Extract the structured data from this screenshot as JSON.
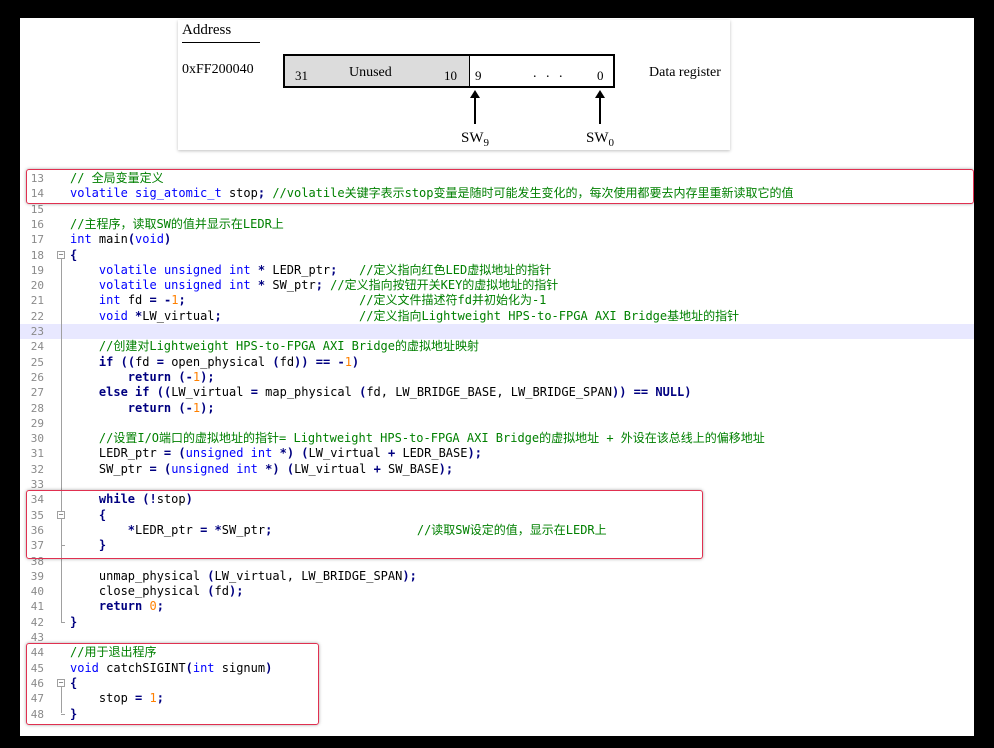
{
  "diagram": {
    "address_header": "Address",
    "address_value": "0xFF200040",
    "bit_31": "31",
    "unused_label": "Unused",
    "bit_10": "10",
    "bit_9": "9",
    "ellipsis": ". . .",
    "bit_0": "0",
    "register_name": "Data register",
    "sw9_base": "SW",
    "sw9_sub": "9",
    "sw0_base": "SW",
    "sw0_sub": "0"
  },
  "editor": {
    "lines": [
      {
        "n": "13",
        "code": "// 全局变量定义"
      },
      {
        "n": "14",
        "code": "volatile sig_atomic_t stop; //volatile关键字表示stop变量是随时可能发生变化的，每次使用都要去内存里重新读取它的值"
      },
      {
        "n": "15",
        "code": ""
      },
      {
        "n": "16",
        "code": "//主程序，读取SW的值并显示在LEDR上"
      },
      {
        "n": "17",
        "code": "int main(void)"
      },
      {
        "n": "18",
        "code": "{"
      },
      {
        "n": "19",
        "code": "    volatile unsigned int * LEDR_ptr;   //定义指向红色LED虚拟地址的指针"
      },
      {
        "n": "20",
        "code": "    volatile unsigned int * SW_ptr; //定义指向按钮开关KEY的虚拟地址的指针"
      },
      {
        "n": "21",
        "code": "    int fd = -1;                        //定义文件描述符fd并初始化为-1"
      },
      {
        "n": "22",
        "code": "    void *LW_virtual;                   //定义指向Lightweight HPS-to-FPGA AXI Bridge基地址的指针"
      },
      {
        "n": "23",
        "code": ""
      },
      {
        "n": "24",
        "code": "    //创建对Lightweight HPS-to-FPGA AXI Bridge的虚拟地址映射"
      },
      {
        "n": "25",
        "code": "    if ((fd = open_physical (fd)) == -1)"
      },
      {
        "n": "26",
        "code": "        return (-1);"
      },
      {
        "n": "27",
        "code": "    else if ((LW_virtual = map_physical (fd, LW_BRIDGE_BASE, LW_BRIDGE_SPAN)) == NULL)"
      },
      {
        "n": "28",
        "code": "        return (-1);"
      },
      {
        "n": "29",
        "code": ""
      },
      {
        "n": "30",
        "code": "    //设置I/O端口的虚拟地址的指针= Lightweight HPS-to-FPGA AXI Bridge的虚拟地址 + 外设在该总线上的偏移地址"
      },
      {
        "n": "31",
        "code": "    LEDR_ptr = (unsigned int *) (LW_virtual + LEDR_BASE);"
      },
      {
        "n": "32",
        "code": "    SW_ptr = (unsigned int *) (LW_virtual + SW_BASE);"
      },
      {
        "n": "33",
        "code": ""
      },
      {
        "n": "34",
        "code": "    while (!stop)"
      },
      {
        "n": "35",
        "code": "    {"
      },
      {
        "n": "36",
        "code": "        *LEDR_ptr = *SW_ptr;                    //读取SW设定的值，显示在LEDR上"
      },
      {
        "n": "37",
        "code": "    }"
      },
      {
        "n": "38",
        "code": ""
      },
      {
        "n": "39",
        "code": "    unmap_physical (LW_virtual, LW_BRIDGE_SPAN);"
      },
      {
        "n": "40",
        "code": "    close_physical (fd);"
      },
      {
        "n": "41",
        "code": "    return 0;"
      },
      {
        "n": "42",
        "code": "}"
      },
      {
        "n": "43",
        "code": ""
      },
      {
        "n": "44",
        "code": "//用于退出程序"
      },
      {
        "n": "45",
        "code": "void catchSIGINT(int signum)"
      },
      {
        "n": "46",
        "code": "{"
      },
      {
        "n": "47",
        "code": "    stop = 1;"
      },
      {
        "n": "48",
        "code": "}"
      }
    ]
  },
  "colors": {
    "keyword": "#0000ff",
    "bold_keyword": "#000080",
    "comment": "#008000",
    "number": "#ff8000",
    "highlight_box": "#e03050",
    "current_line": "#e8e8ff"
  }
}
